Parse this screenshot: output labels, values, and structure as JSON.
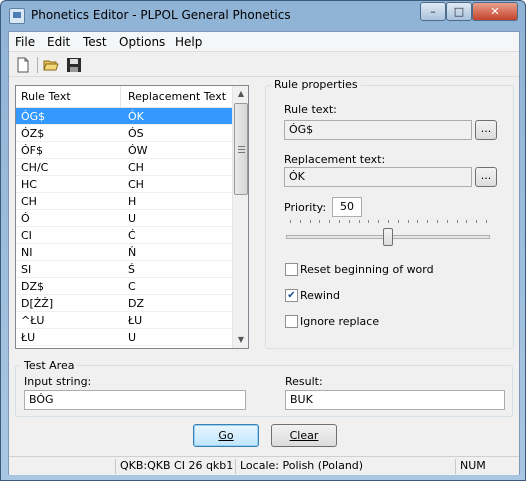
{
  "window": {
    "title": "Phonetics Editor - PLPOL General Phonetics",
    "min_glyph": "–",
    "max_glyph": "□",
    "close_glyph": "✕"
  },
  "menu": [
    "File",
    "Edit",
    "Test",
    "Options",
    "Help"
  ],
  "toolbar": {
    "icons": [
      "new-document-icon",
      "open-folder-icon",
      "save-disk-icon"
    ]
  },
  "rules": {
    "columns": [
      "Rule Text",
      "Replacement Text"
    ],
    "rows": [
      [
        "ÓG$",
        "ÓK"
      ],
      [
        "ÓZ$",
        "ÓS"
      ],
      [
        "ÓF$",
        "ÓW"
      ],
      [
        "CH/C",
        "CH"
      ],
      [
        "HC",
        "CH"
      ],
      [
        "CH",
        "H"
      ],
      [
        "Ó",
        "U"
      ],
      [
        "CI",
        "Ć"
      ],
      [
        "NI",
        "Ń"
      ],
      [
        "SI",
        "Ś"
      ],
      [
        "DZ$",
        "C"
      ],
      [
        "D[ŹŻ]",
        "DZ"
      ],
      [
        "^ŁU",
        "ŁU"
      ],
      [
        "ŁU",
        "U"
      ]
    ],
    "selected_index": 0
  },
  "properties": {
    "title": "Rule properties",
    "rule_text_label": "Rule text:",
    "rule_text_value": "ÓG$",
    "replacement_label": "Replacement text:",
    "replacement_value": "ÓK",
    "ellipsis": "...",
    "priority_label": "Priority:",
    "priority_value": "50",
    "priority_slider_fraction": 0.5,
    "checkboxes": [
      {
        "label": "Reset beginning of word",
        "checked": false
      },
      {
        "label": "Rewind",
        "checked": true
      },
      {
        "label": "Ignore replace",
        "checked": false
      }
    ]
  },
  "test_area": {
    "title": "Test Area",
    "input_label": "Input string:",
    "input_value": "BÓG",
    "result_label": "Result:",
    "result_value": "BUK",
    "go_label": "Go",
    "clear_label": "Clear"
  },
  "status": {
    "qkb": "QKB:QKB CI 26 qkb1",
    "locale": "Locale: Polish (Poland)",
    "num": "NUM"
  }
}
